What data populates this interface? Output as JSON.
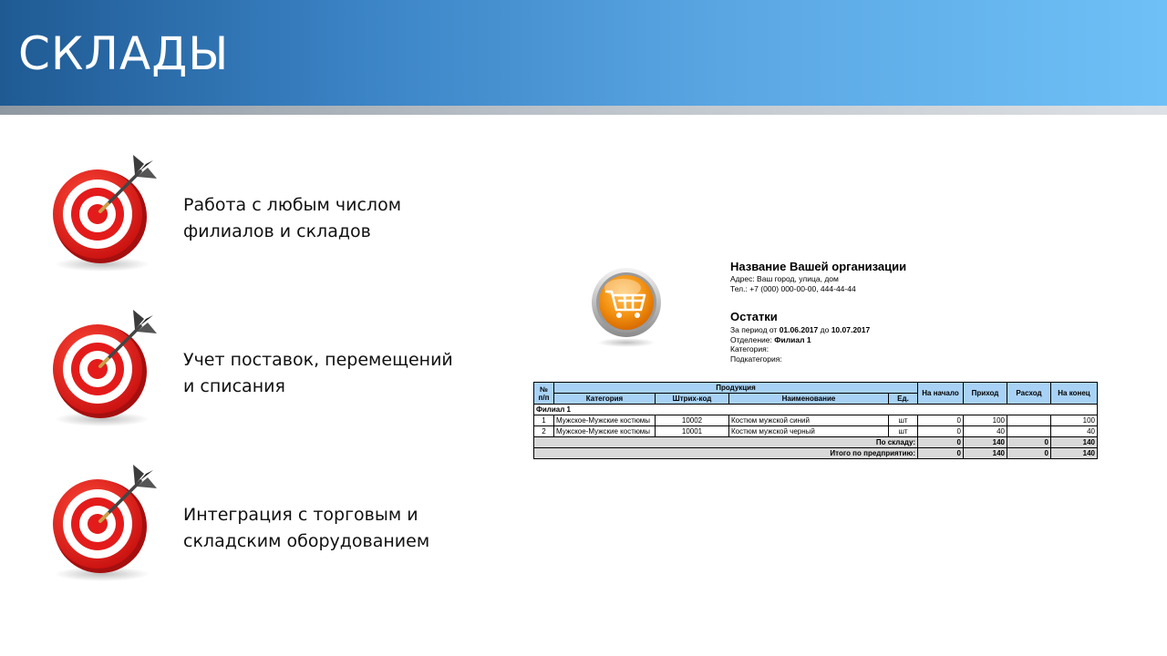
{
  "header": {
    "title": "СКЛАДЫ"
  },
  "features": [
    {
      "icon": "target-icon",
      "lines": [
        "Работа с любым числом",
        "филиалов и складов"
      ]
    },
    {
      "icon": "target-icon",
      "lines": [
        "Учет поставок, перемещений",
        "и списания"
      ]
    },
    {
      "icon": "target-icon",
      "lines": [
        "Интеграция с торговым и",
        "складским оборудованием"
      ]
    }
  ],
  "report": {
    "logo_icon": "shopping-cart-icon",
    "org_name": "Название Вашей организации",
    "address": "Адрес: Ваш город, улица, дом",
    "phone": "Тел.: +7 (000) 000-00-00, 444-44-44",
    "title": "Остатки",
    "period_label": "За период от",
    "period_from": "01.06.2017",
    "period_to_label": "до",
    "period_to": "10.07.2017",
    "department_label": "Отделение:",
    "department_value": "Филиал 1",
    "category_label": "Категория:",
    "subcategory_label": "Подкатегория:",
    "table": {
      "headers": {
        "num": "№ п/п",
        "products": "Продукция",
        "category": "Категория",
        "barcode": "Штрих-код",
        "name": "Наименование",
        "unit": "Ед.",
        "start": "На начало",
        "income": "Приход",
        "expense": "Расход",
        "end": "На конец"
      },
      "group": "Филиал 1",
      "rows": [
        {
          "num": "1",
          "category": "Мужское-Мужские костюмы",
          "barcode": "10002",
          "name": "Костюм мужской синий",
          "unit": "шт",
          "start": "0",
          "income": "100",
          "expense": "",
          "end": "100"
        },
        {
          "num": "2",
          "category": "Мужское-Мужские костюмы",
          "barcode": "10001",
          "name": "Костюм мужской черный",
          "unit": "шт",
          "start": "0",
          "income": "40",
          "expense": "",
          "end": "40"
        }
      ],
      "warehouse_total": {
        "label": "По складу:",
        "start": "0",
        "income": "140",
        "expense": "0",
        "end": "140"
      },
      "company_total": {
        "label": "Итого по предприятию:",
        "start": "0",
        "income": "140",
        "expense": "0",
        "end": "140"
      }
    }
  },
  "colors": {
    "header_gradient_start": "#1f5a93",
    "header_gradient_end": "#6fc0f7",
    "target_red": "#e31b1b",
    "table_header_blue": "#a8d2f5",
    "cart_orange": "#f39212"
  }
}
